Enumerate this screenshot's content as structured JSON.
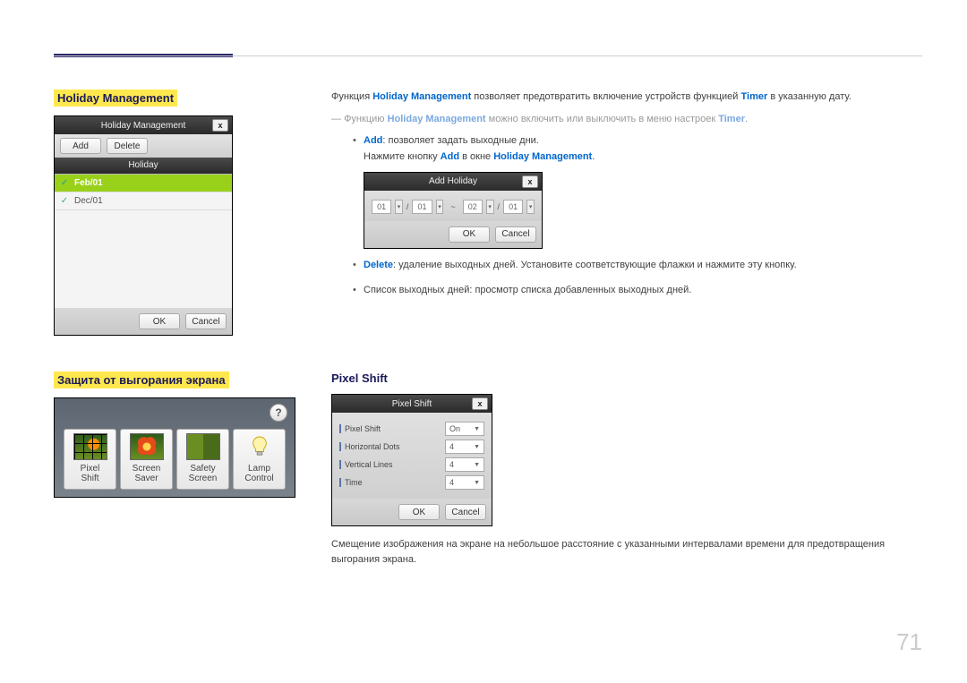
{
  "page_number": "71",
  "section1": {
    "title": "Holiday Management",
    "para1_a": "Функция ",
    "para1_b": "Holiday Management",
    "para1_c": " позволяет предотвратить включение устройств функцией ",
    "para1_d": "Timer",
    "para1_e": " в указанную дату.",
    "note_dash": "―",
    "note_a": "Функцию ",
    "note_b": "Holiday Management",
    "note_c": " можно включить или выключить в меню настроек ",
    "note_d": "Timer",
    "note_e": ".",
    "add_bullet_a": "Add",
    "add_bullet_b": ": позволяет задать выходные дни.",
    "add_line2_a": "Нажмите кнопку ",
    "add_line2_b": "Add",
    "add_line2_c": " в окне ",
    "add_line2_d": "Holiday Management",
    "add_line2_e": ".",
    "delete_bullet_a": "Delete",
    "delete_bullet_b": ": удаление выходных дней. Установите соответствующие флажки и нажмите эту кнопку.",
    "list_bullet": "Список выходных дней: просмотр списка добавленных выходных дней."
  },
  "hm_window": {
    "title": "Holiday Management",
    "close": "x",
    "btn_add": "Add",
    "btn_delete": "Delete",
    "col_header": "Holiday",
    "rows": [
      "Feb/01",
      "Dec/01"
    ],
    "ok": "OK",
    "cancel": "Cancel"
  },
  "ah_window": {
    "title": "Add Holiday",
    "close": "x",
    "m1": "01",
    "d1": "01",
    "sep": "~",
    "m2": "02",
    "d2": "01",
    "slash": "/",
    "ok": "OK",
    "cancel": "Cancel"
  },
  "section2": {
    "title": "Защита от выгорания экрана",
    "sub_title": "Pixel Shift",
    "para": "Смещение изображения на экране на небольшое расстояние с указанными интервалами времени для предотвращения выгорания экрана."
  },
  "sp_window": {
    "help": "?",
    "items": [
      {
        "line1": "Pixel",
        "line2": "Shift"
      },
      {
        "line1": "Screen",
        "line2": "Saver"
      },
      {
        "line1": "Safety",
        "line2": "Screen"
      },
      {
        "line1": "Lamp",
        "line2": "Control"
      }
    ]
  },
  "ps_window": {
    "title": "Pixel Shift",
    "close": "x",
    "rows": [
      {
        "label": "Pixel Shift",
        "value": "On"
      },
      {
        "label": "Horizontal Dots",
        "value": "4"
      },
      {
        "label": "Vertical Lines",
        "value": "4"
      },
      {
        "label": "Time",
        "value": "4"
      }
    ],
    "ok": "OK",
    "cancel": "Cancel"
  }
}
